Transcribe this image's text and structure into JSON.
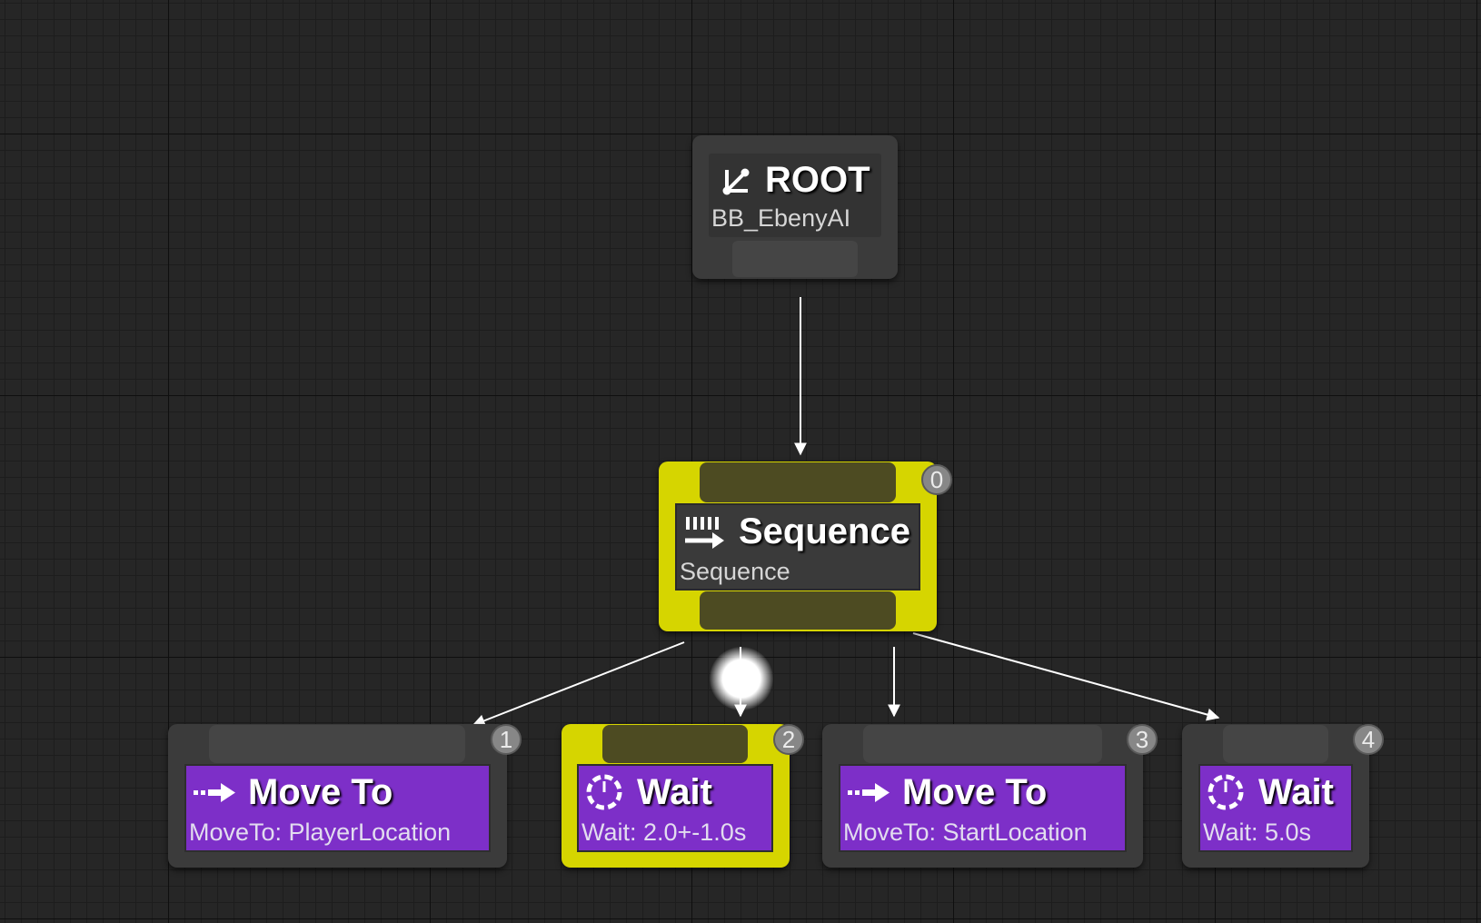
{
  "graph": {
    "root": {
      "title": "ROOT",
      "subtitle": "BB_EbenyAI",
      "icon": "root-branch-icon"
    },
    "sequence": {
      "title": "Sequence",
      "subtitle": "Sequence",
      "index": "0",
      "icon": "sequence-icon",
      "active": true
    },
    "tasks": [
      {
        "title": "Move To",
        "subtitle": "MoveTo: PlayerLocation",
        "index": "1",
        "icon": "move-to-arrow-icon",
        "active": false
      },
      {
        "title": "Wait",
        "subtitle": "Wait: 2.0+-1.0s",
        "index": "2",
        "icon": "wait-clock-icon",
        "active": true
      },
      {
        "title": "Move To",
        "subtitle": "MoveTo: StartLocation",
        "index": "3",
        "icon": "move-to-arrow-icon",
        "active": false
      },
      {
        "title": "Wait",
        "subtitle": "Wait: 5.0s",
        "index": "4",
        "icon": "wait-clock-icon",
        "active": false
      }
    ]
  },
  "colors": {
    "background": "#262626",
    "node": "#3b3b3b",
    "active_highlight": "#d6d500",
    "task": "#7d2fc8",
    "badge": "#878787",
    "wire": "#ffffff"
  }
}
